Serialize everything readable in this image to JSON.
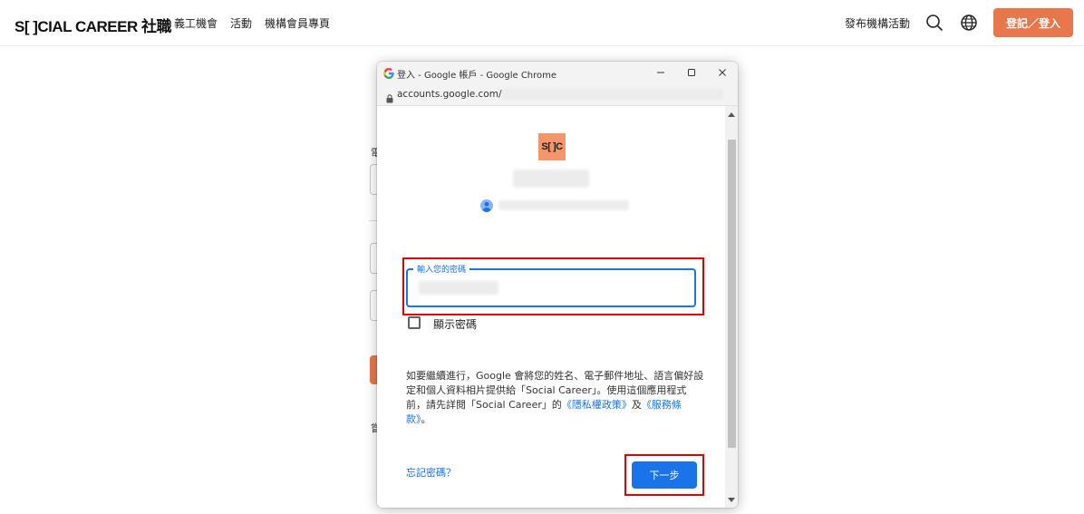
{
  "site": {
    "logo": "S[ ]CIAL CAREER 社職",
    "nav": [
      "義工機會",
      "活動",
      "機構會員專頁"
    ],
    "post_event": "發布機構活動",
    "login_button": "登記／登入",
    "accent_color": "#e8784c"
  },
  "background_form": {
    "chars": [
      "電",
      "嘗"
    ]
  },
  "popup": {
    "title": "登入 - Google 帳戶 - Google Chrome",
    "url": "accounts.google.com/",
    "app_logo": "S[ ]C",
    "password_label": "輸入您的密碼",
    "show_password_label": "顯示密碼",
    "consent_text": {
      "part1": "如要繼續進行，Google 會將您的姓名、電子郵件地址、語言偏好設定和個人資料相片提供給「Social Career」。使用這個應用程式前，請先詳閱「Social Career」的",
      "privacy_link": "《隱私權政策》",
      "and": "及",
      "terms_link": "《服務條款》",
      "end": "。"
    },
    "forgot_password": "忘記密碼？",
    "next_button": "下一步",
    "primary_color": "#1a73e8",
    "highlight_color": "#e00000"
  }
}
